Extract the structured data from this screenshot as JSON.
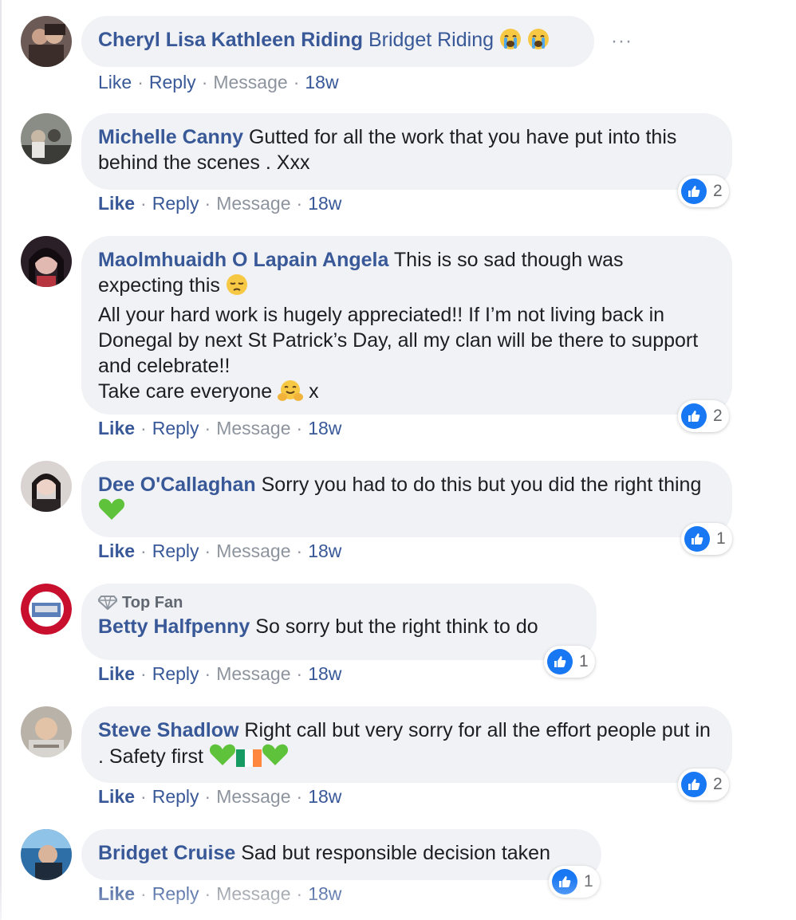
{
  "actions": {
    "like": "Like",
    "reply": "Reply",
    "message": "Message",
    "sep": "·"
  },
  "colors": {
    "author": "#385898",
    "bubble": "#f0f2f5",
    "like_blue": "#1877f2",
    "meta": "#8d949e"
  },
  "comments": [
    {
      "author": "Cheryl Lisa Kathleen Riding",
      "text": "Bridget Riding",
      "emoji_after": [
        "crying-face-emoji",
        "crying-face-emoji"
      ],
      "time": "18w",
      "reactions": null
    },
    {
      "author": "Michelle Canny",
      "text": "Gutted for all the work that you have put into this behind the scenes . Xxx",
      "time": "18w",
      "reactions": "2"
    },
    {
      "author": "Maolmhuaidh O Lapain Angela",
      "text_line1": "This is so sad though was",
      "text_line2": "expecting this",
      "text_line3": "All your hard work is hugely appreciated!! If I’m not living back in Donegal by next St Patrick’s Day, all my clan will be there to support and celebrate!!",
      "text_line4": "Take care everyone",
      "text_tail": "x",
      "time": "18w",
      "reactions": "2"
    },
    {
      "author": "Dee O'Callaghan",
      "text": "Sorry you had to do this but you did the right thing",
      "time": "18w",
      "reactions": "1"
    },
    {
      "badge": "Top Fan",
      "author": "Betty Halfpenny",
      "text": "So sorry but the right think to do",
      "time": "18w",
      "reactions": "1"
    },
    {
      "author": "Steve Shadlow",
      "text": "Right call but very sorry for all the effort people put in . Safety first",
      "time": "18w",
      "reactions": "2"
    },
    {
      "author": "Bridget Cruise",
      "text": "Sad but responsible decision taken",
      "time": "18w",
      "reactions": "1"
    }
  ],
  "more_options": "···"
}
